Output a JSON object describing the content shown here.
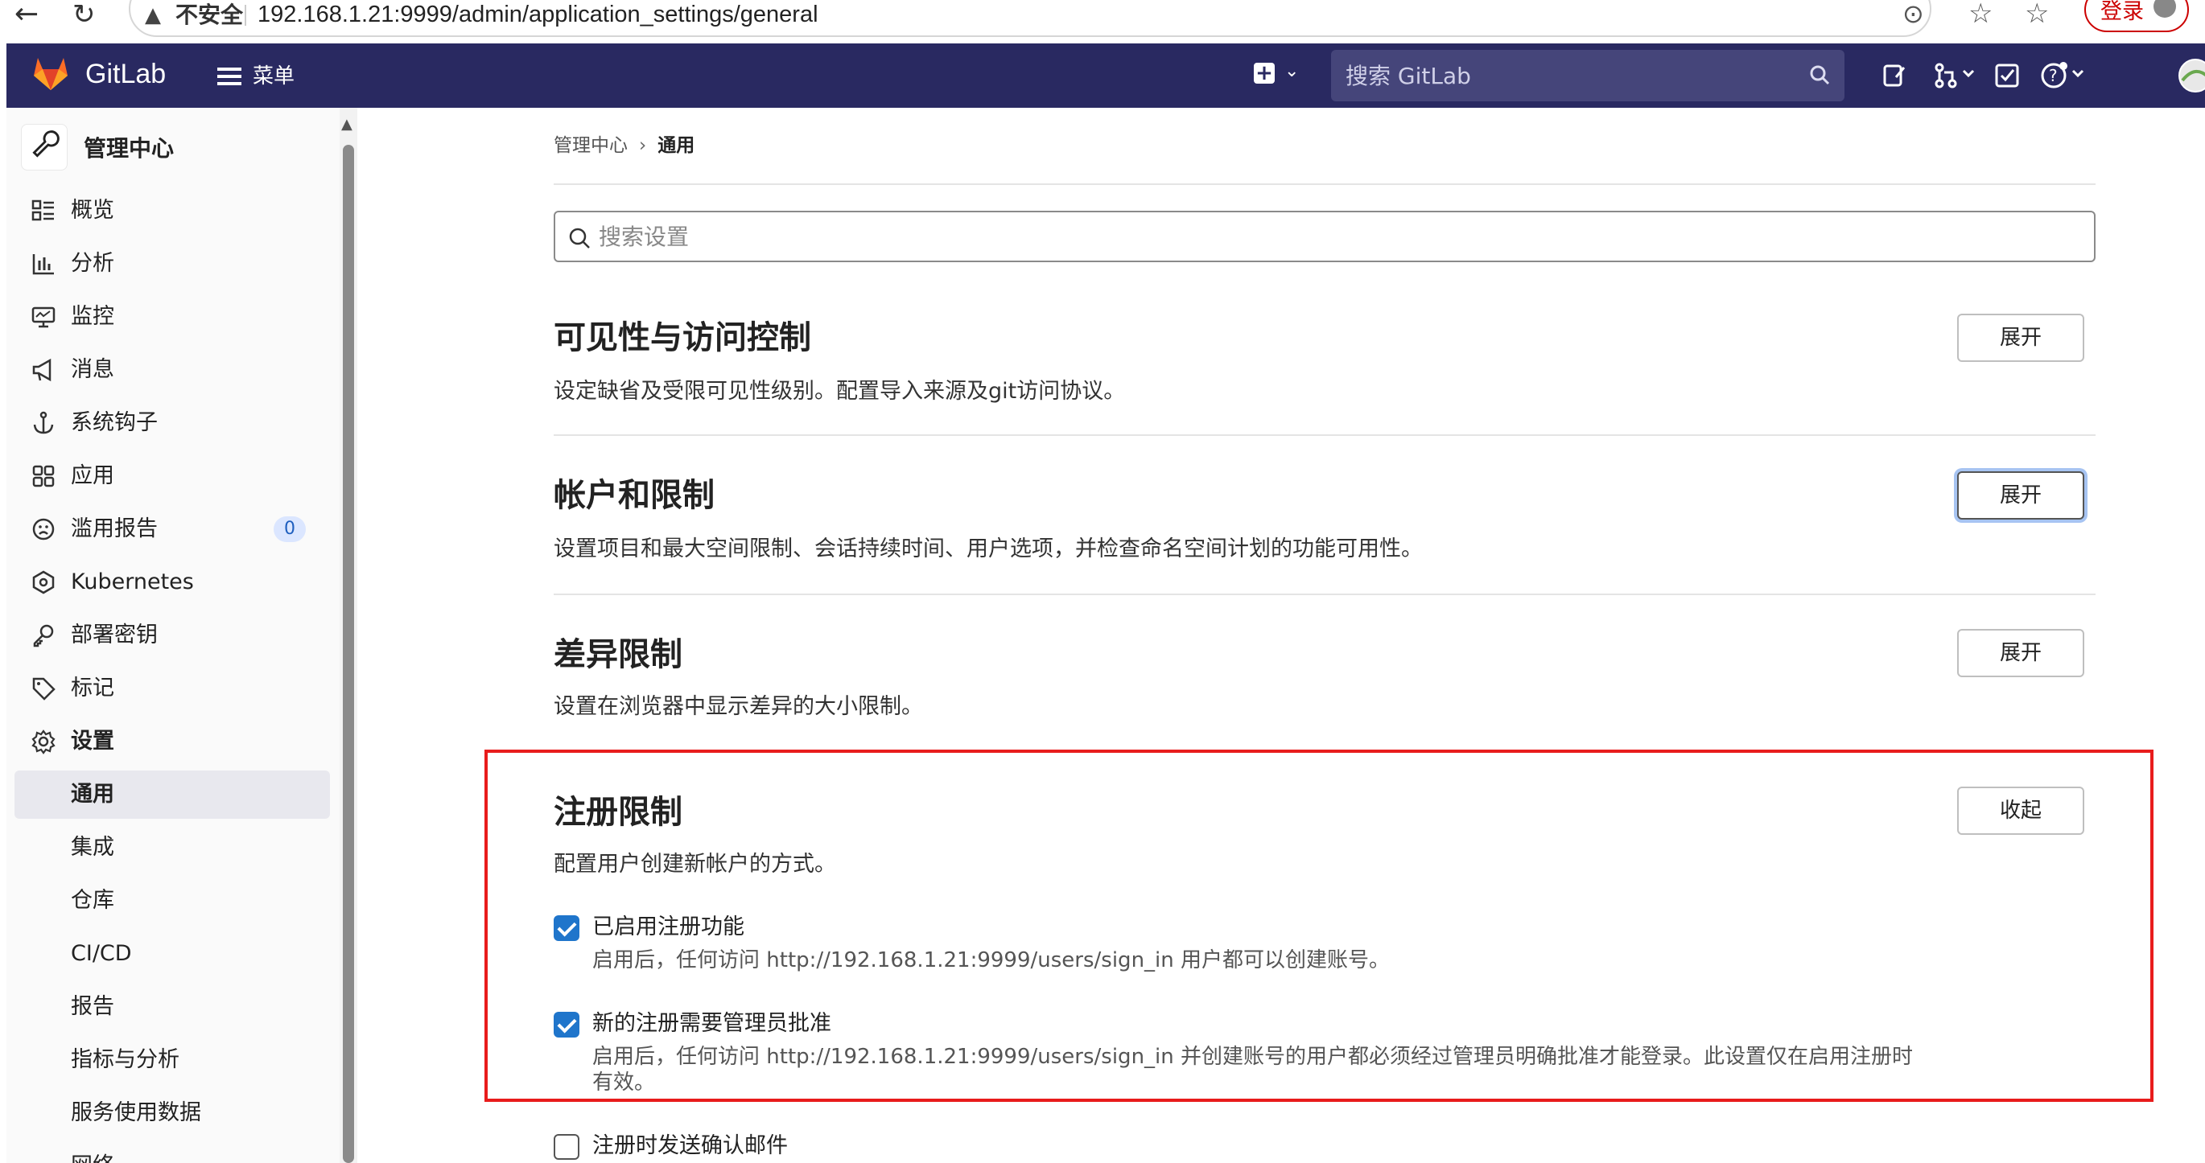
{
  "browser": {
    "security_label": "不安全",
    "url": "192.168.1.21:9999/admin/application_settings/general",
    "login_label": "登录"
  },
  "header": {
    "brand": "GitLab",
    "menu_label": "菜单",
    "search_placeholder": "搜索 GitLab",
    "brand_color": "#292961"
  },
  "sidebar": {
    "context_title": "管理中心",
    "items": [
      {
        "label": "概览",
        "icon": "overview-icon"
      },
      {
        "label": "分析",
        "icon": "chart-icon"
      },
      {
        "label": "监控",
        "icon": "monitor-icon"
      },
      {
        "label": "消息",
        "icon": "megaphone-icon"
      },
      {
        "label": "系统钩子",
        "icon": "anchor-icon"
      },
      {
        "label": "应用",
        "icon": "apps-icon"
      },
      {
        "label": "滥用报告",
        "icon": "abuse-face-icon",
        "badge": "0"
      },
      {
        "label": "Kubernetes",
        "icon": "kubernetes-icon"
      },
      {
        "label": "部署密钥",
        "icon": "key-icon"
      },
      {
        "label": "标记",
        "icon": "label-icon"
      },
      {
        "label": "设置",
        "icon": "gear-icon"
      }
    ],
    "sub_items": [
      "通用",
      "集成",
      "仓库",
      "CI/CD",
      "报告",
      "指标与分析",
      "服务使用数据",
      "网络"
    ]
  },
  "breadcrumb": {
    "parent": "管理中心",
    "current": "通用"
  },
  "settings_search": {
    "placeholder": "搜索设置"
  },
  "sections": [
    {
      "title": "可见性与访问控制",
      "description": "设定缺省及受限可见性级别。配置导入来源及git访问协议。",
      "button": "展开"
    },
    {
      "title": "帐户和限制",
      "description": "设置项目和最大空间限制、会话持续时间、用户选项，并检查命名空间计划的功能可用性。",
      "button": "展开"
    },
    {
      "title": "差异限制",
      "description": "设置在浏览器中显示差异的大小限制。",
      "button": "展开"
    },
    {
      "title": "注册限制",
      "description": "配置用户创建新帐户的方式。",
      "button": "收起"
    }
  ],
  "signup": {
    "enabled": {
      "label": "已启用注册功能",
      "help": "启用后，任何访问 http://192.168.1.21:9999/users/sign_in 用户都可以创建账号。",
      "checked": true
    },
    "approval": {
      "label": "新的注册需要管理员批准",
      "help": "启用后，任何访问 http://192.168.1.21:9999/users/sign_in 并创建账号的用户都必须经过管理员明确批准才能登录。此设置仅在启用注册时有效。",
      "checked": true
    },
    "confirm_email": {
      "label": "注册时发送确认邮件",
      "checked": false
    }
  },
  "colors": {
    "highlight_box": "#e81c1c",
    "checkbox_on": "#1f75cb"
  }
}
